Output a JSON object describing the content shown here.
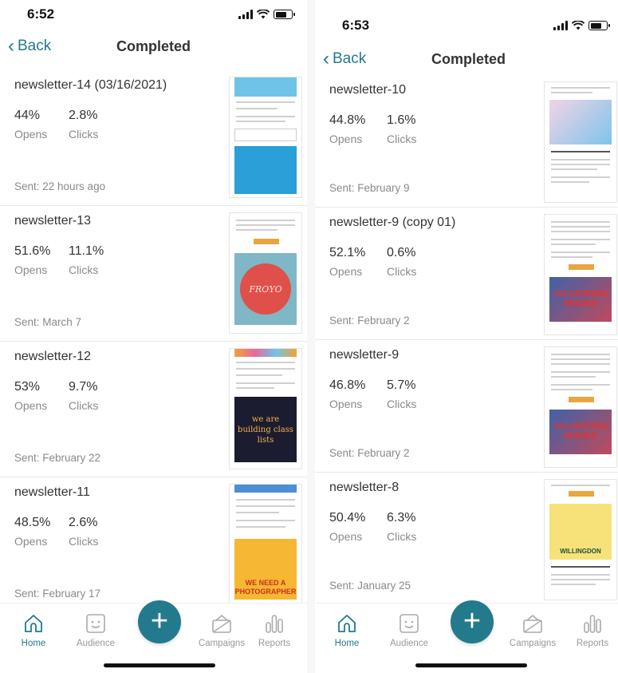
{
  "colors": {
    "accent": "#237a8c",
    "muted": "#8a8a8a",
    "text": "#333333"
  },
  "tabs": [
    {
      "label": "Home",
      "icon": "home-icon",
      "active": true
    },
    {
      "label": "Audience",
      "icon": "audience-icon",
      "active": false
    },
    {
      "label": "Campaigns",
      "icon": "campaigns-icon",
      "active": false
    },
    {
      "label": "Reports",
      "icon": "reports-icon",
      "active": false
    }
  ],
  "fab_label": "+",
  "screens": [
    {
      "time": "6:52",
      "back_label": "Back",
      "title": "Completed",
      "newsletters": [
        {
          "name": "newsletter-14 (03/16/2021)",
          "opens": "44%",
          "clicks": "2.8%",
          "sent": "Sent: 22 hours ago",
          "opens_label": "Opens",
          "clicks_label": "Clicks"
        },
        {
          "name": "newsletter-13",
          "opens": "51.6%",
          "clicks": "11.1%",
          "sent": "Sent: March 7",
          "opens_label": "Opens",
          "clicks_label": "Clicks"
        },
        {
          "name": "newsletter-12",
          "opens": "53%",
          "clicks": "9.7%",
          "sent": "Sent: February 22",
          "opens_label": "Opens",
          "clicks_label": "Clicks"
        },
        {
          "name": "newsletter-11",
          "opens": "48.5%",
          "clicks": "2.6%",
          "sent": "Sent: February 17",
          "opens_label": "Opens",
          "clicks_label": "Clicks"
        }
      ]
    },
    {
      "time": "6:53",
      "back_label": "Back",
      "title": "Completed",
      "newsletters": [
        {
          "name": "newsletter-10",
          "opens": "44.8%",
          "clicks": "1.6%",
          "sent": "Sent: February 9",
          "opens_label": "Opens",
          "clicks_label": "Clicks"
        },
        {
          "name": "newsletter-9 (copy 01)",
          "opens": "52.1%",
          "clicks": "0.6%",
          "sent": "Sent: February 2",
          "opens_label": "Opens",
          "clicks_label": "Clicks"
        },
        {
          "name": "newsletter-9",
          "opens": "46.8%",
          "clicks": "5.7%",
          "sent": "Sent: February 2",
          "opens_label": "Opens",
          "clicks_label": "Clicks"
        },
        {
          "name": "newsletter-8",
          "opens": "50.4%",
          "clicks": "6.3%",
          "sent": "Sent: January 25",
          "opens_label": "Opens",
          "clicks_label": "Clicks"
        }
      ]
    }
  ],
  "thumbnail_text": {
    "froyo": "FROYO",
    "class_lists": "we are building class lists",
    "photographer": "WE NEED A PHOTOGRAPHER",
    "volunteers": "VOLUNTEERS NEEDED",
    "willingdon": "WILLINGDON"
  }
}
